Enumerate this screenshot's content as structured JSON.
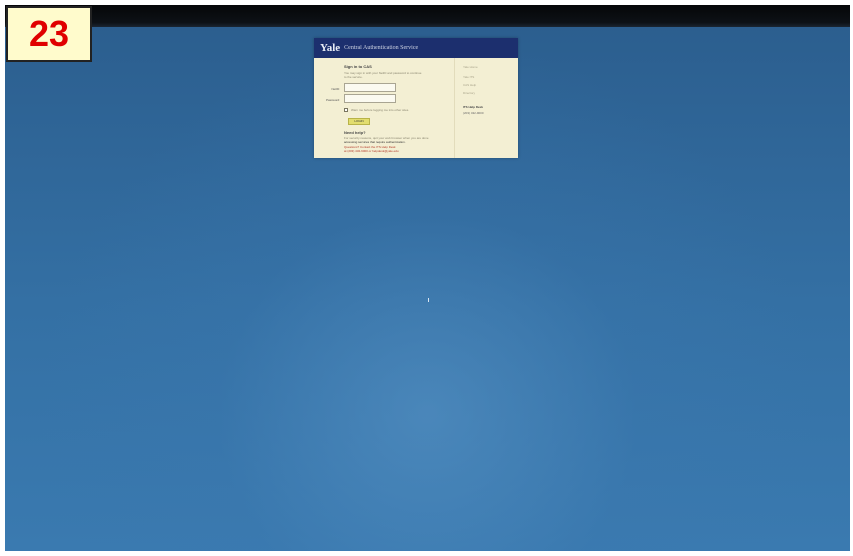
{
  "badge": {
    "number": "23"
  },
  "login_card": {
    "logo": "Yale",
    "title": "Central Authentication Service",
    "heading": "Sign in to CAS",
    "intro_line_1": "You may sign in with your NetID and password to continue",
    "intro_line_2": "to the service.",
    "netid_label": "NetID:",
    "password_label": "Password:",
    "netid_value": "",
    "password_value": "",
    "warn_label": "Warn me before logging me into other sites.",
    "login_button": "LOGIN",
    "help_heading": "Need help?",
    "help_line_1": "For security reasons, quit your web browser when you are done",
    "help_line_2": "accessing services that require authentication.",
    "help_line_3": "Questions? Contact the ITS Help Desk",
    "help_line_4": "at (203) 432-9000 or helpdesk@yale.edu",
    "side_links": [
      "Yale Home",
      "Yale ITS",
      "CAS Help",
      "Directory"
    ],
    "side_note_1": "ITS Help Desk",
    "side_note_2": "(203) 432-9000"
  },
  "colors": {
    "desktop": "#2e6294",
    "card_header": "#1c2f6e",
    "card_body": "#f3efd3",
    "button": "#e2dd6e",
    "badge_text": "#e00000",
    "badge_bg": "#fffbcc"
  }
}
